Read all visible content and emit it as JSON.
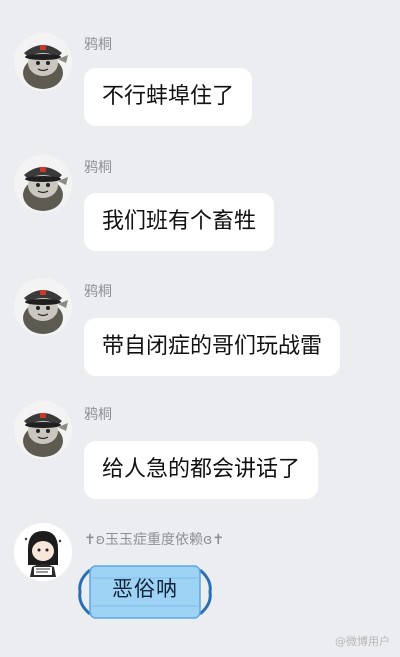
{
  "messages": [
    {
      "sender": "鸦桐",
      "text": "不行蚌埠住了"
    },
    {
      "sender": "鸦桐",
      "text": "我们班有个畜牲"
    },
    {
      "sender": "鸦桐",
      "text": "带自闭症的哥们玩战雷"
    },
    {
      "sender": "鸦桐",
      "text": "给人急的都会讲话了"
    },
    {
      "sender": "✝︎ʚ玉玉症重度依赖ɞ✝︎",
      "text": "恶俗呐"
    }
  ],
  "watermark": "@微博用户"
}
